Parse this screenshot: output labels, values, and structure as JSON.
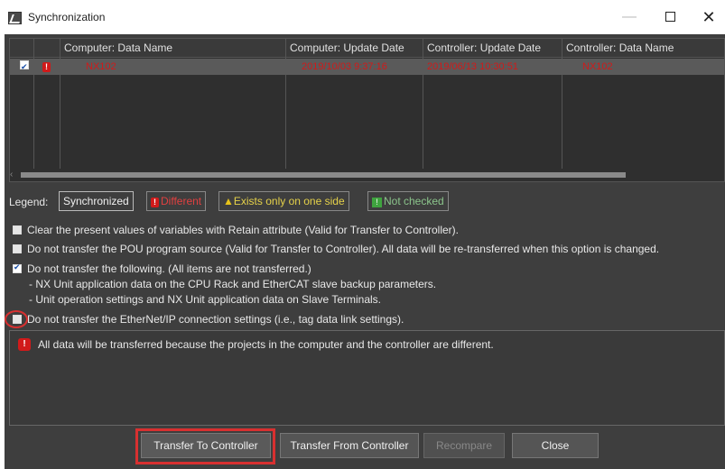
{
  "window": {
    "title": "Synchronization",
    "minimize": "—",
    "maximize": "",
    "close": "✕"
  },
  "grid": {
    "columns": [
      "Computer: Data Name",
      "Computer: Update Date",
      "Controller: Update Date",
      "Controller: Data Name"
    ],
    "rows": [
      {
        "checked": true,
        "status": "different",
        "status_glyph": "!",
        "computer_name": "NX102",
        "computer_date": "2019/10/03 9:37:16",
        "controller_date": "2019/06/13 10:30:51",
        "controller_name": "NX102"
      }
    ]
  },
  "legend": {
    "label": "Legend:",
    "synchronized": "Synchronized",
    "different": "Different",
    "exists_one_side": "Exists only on one side",
    "not_checked": "Not checked"
  },
  "options": {
    "retain": {
      "checked": false,
      "label": "Clear the present values of variables with Retain attribute (Valid for Transfer to Controller)."
    },
    "pou": {
      "checked": false,
      "label": "Do not transfer the POU program source (Valid for Transfer to Controller). All data will be re-transferred when this option is changed."
    },
    "following": {
      "checked": true,
      "label": "Do not transfer the following. (All items are not transferred.)"
    },
    "following_sub1": "- NX Unit application data on the CPU Rack and EtherCAT slave backup parameters.",
    "following_sub2": "- Unit operation settings and NX Unit application data on Slave Terminals.",
    "ethernetip": {
      "checked": false,
      "label": "Do not transfer the EtherNet/IP connection settings (i.e., tag data link settings)."
    }
  },
  "message": {
    "text": "All data will be transferred because the projects in the computer and the controller are different."
  },
  "buttons": {
    "transfer_to": "Transfer To Controller",
    "transfer_from": "Transfer From Controller",
    "recompare": "Recompare",
    "close": "Close"
  },
  "colors": {
    "error_red": "#d11a1a",
    "highlight_red": "#d83030",
    "panel_dark": "#3e3e3e"
  }
}
